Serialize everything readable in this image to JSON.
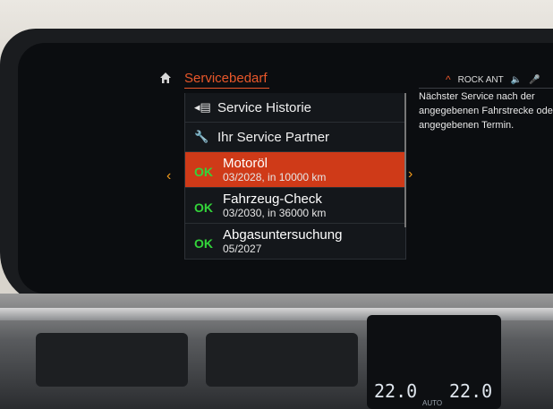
{
  "header": {
    "title": "Servicebedarf"
  },
  "menu": [
    {
      "label": "Service Historie",
      "icon": "service-history-icon"
    },
    {
      "label": "Ihr Service Partner",
      "icon": "wrench-icon"
    }
  ],
  "services": [
    {
      "status": "OK",
      "name": "Motoröl",
      "detail": "03/2028, in 10000 km",
      "selected": true
    },
    {
      "status": "OK",
      "name": "Fahrzeug-Check",
      "detail": "03/2030, in 36000 km",
      "selected": false
    },
    {
      "status": "OK",
      "name": "Abgasuntersuchung",
      "detail": "05/2027",
      "selected": false
    }
  ],
  "media": {
    "station": "ROCK ANT"
  },
  "info_panel": {
    "text": "Nächster Service nach der angegebenen Fahrstrecke oder angegebenen Termin."
  },
  "climate": {
    "left_temp": "22.0",
    "right_temp": "22.0",
    "mode": "AUTO"
  },
  "colors": {
    "accent": "#e8572a",
    "selected": "#cf3a18",
    "ok": "#33d43a",
    "chevron": "#f29a1a"
  }
}
